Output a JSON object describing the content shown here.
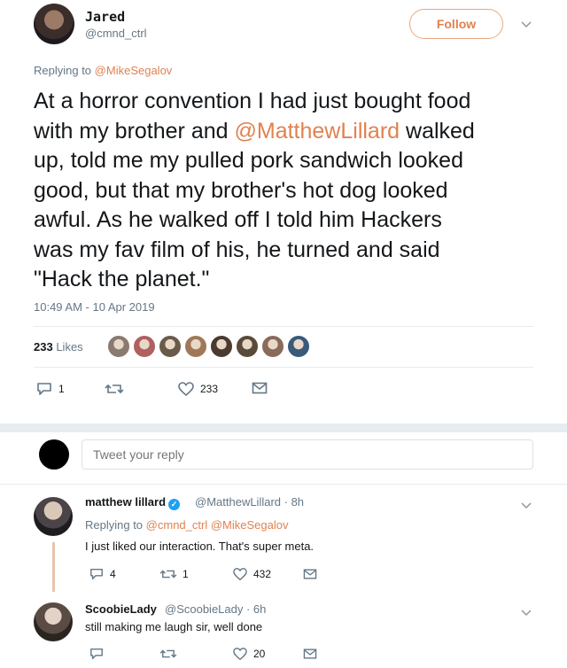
{
  "tweet": {
    "author_name": "Jared",
    "author_handle": "@cmnd_ctrl",
    "follow_label": "Follow",
    "replying_prefix": "Replying to",
    "replying_to": "@MikeSegalov",
    "text_line_1": "At a horror convention I had just bought food",
    "text_line_2_before": "with my brother and",
    "text_line_2_link": "@MatthewLillard",
    "text_line_2_after": "walked",
    "text_line_3": "up, told me my pulled pork sandwich looked",
    "text_line_4": "good, but that my brother's hot dog looked",
    "text_line_5": "awful. As he walked off I told him Hackers",
    "text_line_6": "was my fav film of his, he turned and said",
    "text_line_7": "\"Hack the planet.\"",
    "timestamp": "10:49 AM - 10 Apr 2019",
    "likes_count": "233",
    "likes_label": "Likes",
    "likers": [
      "#8a7a70",
      "#b06060",
      "#6a5a4a",
      "#a07858",
      "#4a3a30",
      "#5a4a3a",
      "#8a6a5a",
      "#3a5a7a"
    ],
    "actions": {
      "reply_count": "1",
      "retweet_count": "",
      "like_count": "233"
    }
  },
  "composer": {
    "placeholder": "Tweet your reply"
  },
  "replies": [
    {
      "name": "matthew lillard",
      "handle_time": "@MatthewLillard · 8h",
      "replying_prefix": "Replying to",
      "replying_to": "@cmnd_ctrl @MikeSegalov",
      "text": "I just liked our interaction. That's super meta.",
      "reply_count": "4",
      "retweet_count": "1",
      "like_count": "432"
    },
    {
      "name": "ScoobieLady",
      "handle_time": "@ScoobieLady · 6h",
      "text": "still making me laugh sir, well done",
      "reply_count": "",
      "retweet_count": "",
      "like_count": "20"
    }
  ],
  "colors": {
    "accent": "#e0824f",
    "muted": "#657786",
    "divider": "#e6ecf0"
  }
}
